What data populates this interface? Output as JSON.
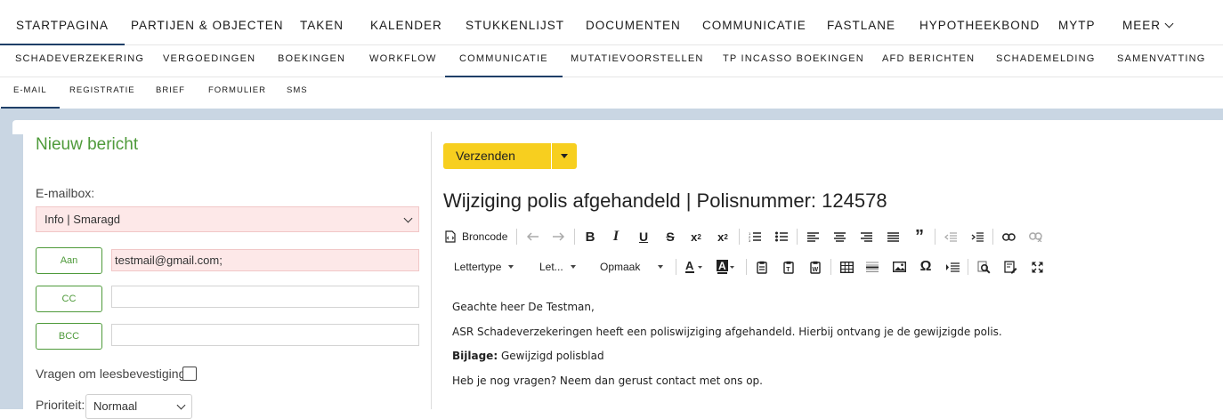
{
  "nav_primary": {
    "items": [
      {
        "label": "STARTPAGINA",
        "active": true
      },
      {
        "label": "PARTIJEN & OBJECTEN",
        "active": false
      },
      {
        "label": "TAKEN",
        "active": false
      },
      {
        "label": "KALENDER",
        "active": false
      },
      {
        "label": "STUKKENLIJST",
        "active": false
      },
      {
        "label": "DOCUMENTEN",
        "active": false
      },
      {
        "label": "COMMUNICATIE",
        "active": false
      },
      {
        "label": "FASTLANE",
        "active": false
      },
      {
        "label": "HYPOTHEEKBOND",
        "active": false
      },
      {
        "label": "MYTP",
        "active": false
      },
      {
        "label": "MEER",
        "active": false
      }
    ]
  },
  "nav_secondary": {
    "items": [
      {
        "label": "SCHADEVERZEKERING"
      },
      {
        "label": "VERGOEDINGEN"
      },
      {
        "label": "BOEKINGEN"
      },
      {
        "label": "WORKFLOW"
      },
      {
        "label": "COMMUNICATIE",
        "active": true
      },
      {
        "label": "MUTATIEVOORSTELLEN"
      },
      {
        "label": "TP INCASSO BOEKINGEN"
      },
      {
        "label": "AFD BERICHTEN"
      },
      {
        "label": "SCHADEMELDING"
      },
      {
        "label": "SAMENVATTING"
      }
    ]
  },
  "nav_tertiary": {
    "items": [
      {
        "label": "E-MAIL",
        "active": true
      },
      {
        "label": "REGISTRATIE"
      },
      {
        "label": "BRIEF"
      },
      {
        "label": "FORMULIER"
      },
      {
        "label": "SMS"
      }
    ]
  },
  "form": {
    "title": "Nieuw bericht",
    "mailbox_label": "E-mailbox:",
    "mailbox_value": "Info | Smaragd",
    "to_button": "Aan",
    "to_value": "testmail@gmail.com;",
    "cc_button": "CC",
    "cc_value": "",
    "bcc_button": "BCC",
    "bcc_value": "",
    "read_receipt_label": "Vragen om leesbevestiging:",
    "read_receipt_checked": false,
    "priority_label": "Prioriteit:",
    "priority_value": "Normaal"
  },
  "editor": {
    "send_label": "Verzenden",
    "subject": "Wijziging polis afgehandeld | Polisnummer: 124578",
    "toolbar": {
      "source_label": "Broncode",
      "font_label": "Lettertype",
      "size_label": "Let...",
      "format_label": "Opmaak"
    },
    "body": {
      "greeting": "Geachte heer De Testman,",
      "paragraph1": "ASR Schadeverzekeringen heeft een poliswijziging afgehandeld. Hierbij ontvang je de gewijzigde polis.",
      "attachment_label": "Bijlage:",
      "attachment_value": "Gewijzigd polisblad",
      "closing": "Heb je nog vragen? Neem dan gerust contact met ons op."
    }
  },
  "colors": {
    "accent_green": "#4e9a3a",
    "send_yellow": "#f7cf1f",
    "active_underline": "#1f3f68",
    "required_field_bg": "#fde8e8",
    "frame_bg": "#c9d6e3"
  }
}
